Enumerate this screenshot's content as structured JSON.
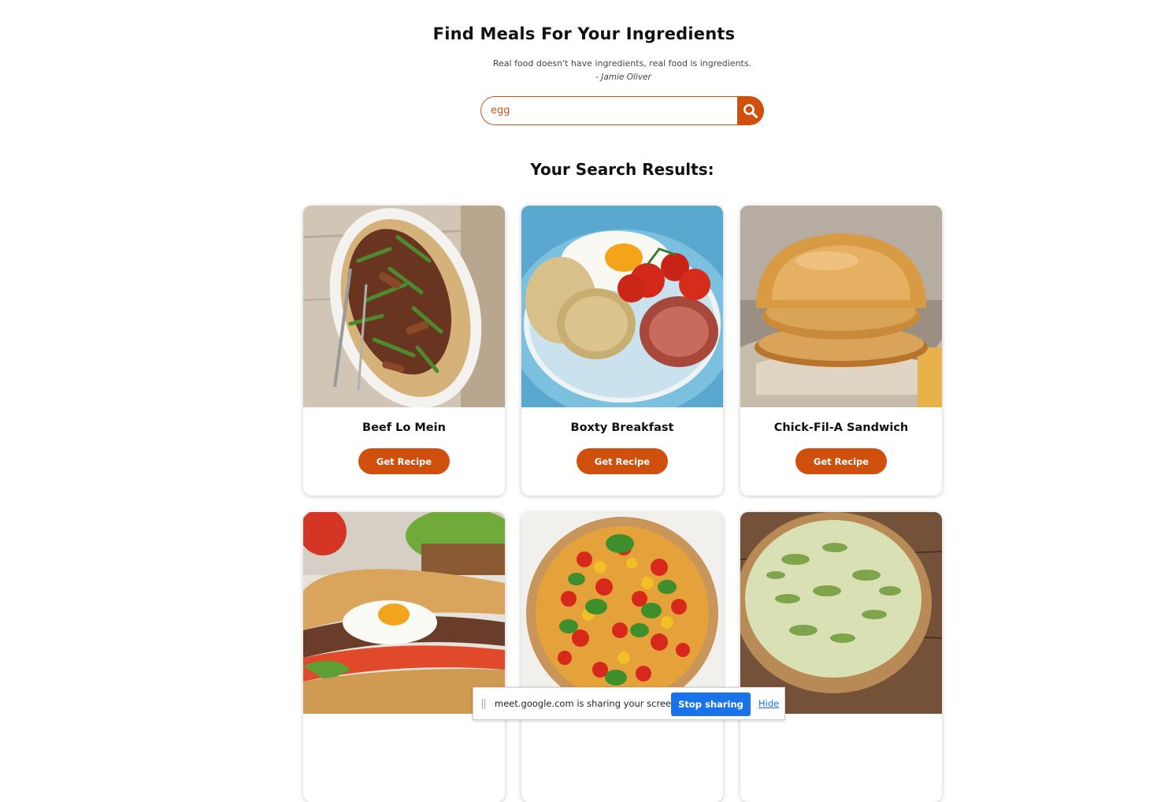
{
  "header": {
    "title": "Find Meals For Your Ingredients",
    "quote": "Real food doesn't have ingredients, real food is ingredients.",
    "quote_author": "- Jamie Oliver"
  },
  "search": {
    "value": "egg",
    "button_icon": "search-icon"
  },
  "results": {
    "heading": "Your Search Results:",
    "cards": [
      {
        "name": "Beef Lo Mein",
        "button": "Get Recipe",
        "image": "beef-lo-mein-photo"
      },
      {
        "name": "Boxty Breakfast",
        "button": "Get Recipe",
        "image": "boxty-breakfast-photo"
      },
      {
        "name": "Chick-Fil-A Sandwich",
        "button": "Get Recipe",
        "image": "chicken-sandwich-photo"
      },
      {
        "name": "",
        "button": "",
        "image": "steak-egg-sub-photo"
      },
      {
        "name": "",
        "button": "",
        "image": "tomato-tart-photo"
      },
      {
        "name": "",
        "button": "",
        "image": "leek-quiche-photo"
      }
    ]
  },
  "share_bar": {
    "text": "meet.google.com is sharing your screen.",
    "stop_label": "Stop sharing",
    "hide_label": "Hide"
  },
  "colors": {
    "accent": "#cf4f0c",
    "share_blue": "#1a73e8"
  }
}
